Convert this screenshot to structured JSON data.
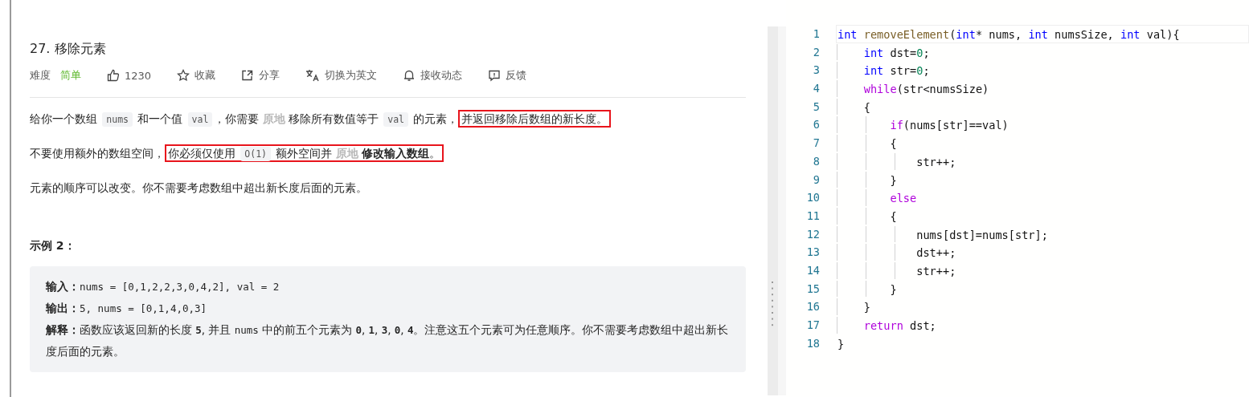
{
  "problem": {
    "title": "27. 移除元素",
    "difficulty": {
      "label": "难度",
      "value": "简单"
    },
    "actions": [
      {
        "kind": "like",
        "label": "1230"
      },
      {
        "kind": "favorite",
        "label": "收藏"
      },
      {
        "kind": "share",
        "label": "分享"
      },
      {
        "kind": "translate",
        "label": "切换为英文"
      },
      {
        "kind": "subscribe",
        "label": "接收动态"
      },
      {
        "kind": "feedback",
        "label": "反馈"
      }
    ],
    "description": [
      {
        "segments": [
          {
            "kind": "text",
            "text": "给你一个数组 "
          },
          {
            "kind": "code",
            "text": "nums"
          },
          {
            "kind": "text",
            "text": " 和一个值 "
          },
          {
            "kind": "code",
            "text": "val"
          },
          {
            "kind": "text",
            "text": "，你需要 "
          },
          {
            "kind": "faded",
            "text": "原地"
          },
          {
            "kind": "text",
            "text": " 移除所有数值等于 "
          },
          {
            "kind": "code",
            "text": "val"
          },
          {
            "kind": "text",
            "text": " 的元素，"
          },
          {
            "kind": "highlight",
            "children": [
              {
                "kind": "text",
                "text": "并返回移除后数组的新长度。"
              }
            ]
          }
        ]
      },
      {
        "segments": [
          {
            "kind": "text",
            "text": "不要使用额外的数组空间，"
          },
          {
            "kind": "highlight",
            "children": [
              {
                "kind": "text",
                "text": "你必须仅使用 "
              },
              {
                "kind": "code",
                "text": "O(1)"
              },
              {
                "kind": "text",
                "text": " 额外空间并 "
              },
              {
                "kind": "faded",
                "text": "原地"
              },
              {
                "kind": "bold",
                "text": " 修改输入数组"
              },
              {
                "kind": "text",
                "text": "。"
              }
            ]
          }
        ]
      },
      {
        "segments": [
          {
            "kind": "text",
            "text": "元素的顺序可以改变。你不需要考虑数组中超出新长度后面的元素。"
          }
        ]
      }
    ],
    "example": {
      "heading": "示例 2：",
      "lines": [
        {
          "segments": [
            {
              "kind": "bold",
              "text": "输入："
            },
            {
              "kind": "mono",
              "text": "nums = [0,1,2,2,3,0,4,2], val = 2"
            }
          ]
        },
        {
          "segments": [
            {
              "kind": "bold",
              "text": "输出："
            },
            {
              "kind": "mono",
              "text": "5, nums = [0,1,4,0,3]"
            }
          ]
        },
        {
          "segments": [
            {
              "kind": "bold",
              "text": "解释："
            },
            {
              "kind": "text",
              "text": "函数应该返回新的长度 "
            },
            {
              "kind": "monobold",
              "text": "5"
            },
            {
              "kind": "text",
              "text": ", 并且 "
            },
            {
              "kind": "mono",
              "text": "nums"
            },
            {
              "kind": "text",
              "text": " 中的前五个元素为 "
            },
            {
              "kind": "monobold",
              "text": "0"
            },
            {
              "kind": "text",
              "text": ", "
            },
            {
              "kind": "monobold",
              "text": "1"
            },
            {
              "kind": "text",
              "text": ", "
            },
            {
              "kind": "monobold",
              "text": "3"
            },
            {
              "kind": "text",
              "text": ", "
            },
            {
              "kind": "monobold",
              "text": "0"
            },
            {
              "kind": "text",
              "text": ", "
            },
            {
              "kind": "monobold",
              "text": "4"
            },
            {
              "kind": "text",
              "text": "。注意这五个元素可为任意顺序。你不需要考虑数组中超出新长度后面的元素。"
            }
          ]
        }
      ]
    }
  },
  "editor": {
    "lines": [
      {
        "number": "1",
        "current": true,
        "tokens": [
          {
            "kind": "keyword",
            "text": "int"
          },
          {
            "kind": "function",
            "text": " removeElement"
          },
          {
            "kind": "plain",
            "text": "("
          },
          {
            "kind": "keyword",
            "text": "int"
          },
          {
            "kind": "plain",
            "text": "* nums, "
          },
          {
            "kind": "keyword",
            "text": "int"
          },
          {
            "kind": "plain",
            "text": " numsSize, "
          },
          {
            "kind": "keyword",
            "text": "int"
          },
          {
            "kind": "plain",
            "text": " val){"
          }
        ]
      },
      {
        "number": "2",
        "current": false,
        "tokens": [
          {
            "kind": "keyword",
            "text": "    int"
          },
          {
            "kind": "plain",
            "text": " dst="
          },
          {
            "kind": "number",
            "text": "0"
          },
          {
            "kind": "plain",
            "text": ";"
          }
        ]
      },
      {
        "number": "3",
        "current": false,
        "tokens": [
          {
            "kind": "keyword",
            "text": "    int"
          },
          {
            "kind": "plain",
            "text": " str="
          },
          {
            "kind": "number",
            "text": "0"
          },
          {
            "kind": "plain",
            "text": ";"
          }
        ]
      },
      {
        "number": "4",
        "current": false,
        "tokens": [
          {
            "kind": "control",
            "text": "    while"
          },
          {
            "kind": "plain",
            "text": "(str<numsSize)"
          }
        ]
      },
      {
        "number": "5",
        "current": false,
        "tokens": [
          {
            "kind": "plain",
            "text": "    {"
          }
        ]
      },
      {
        "number": "6",
        "current": false,
        "tokens": [
          {
            "kind": "control",
            "text": "        if"
          },
          {
            "kind": "plain",
            "text": "(nums[str]==val)"
          }
        ]
      },
      {
        "number": "7",
        "current": false,
        "tokens": [
          {
            "kind": "plain",
            "text": "        {"
          }
        ]
      },
      {
        "number": "8",
        "current": false,
        "tokens": [
          {
            "kind": "plain",
            "text": "            str++;"
          }
        ]
      },
      {
        "number": "9",
        "current": false,
        "tokens": [
          {
            "kind": "plain",
            "text": "        }"
          }
        ]
      },
      {
        "number": "10",
        "current": false,
        "tokens": [
          {
            "kind": "control",
            "text": "        else"
          }
        ]
      },
      {
        "number": "11",
        "current": false,
        "tokens": [
          {
            "kind": "plain",
            "text": "        {"
          }
        ]
      },
      {
        "number": "12",
        "current": false,
        "tokens": [
          {
            "kind": "plain",
            "text": "            nums[dst]=nums[str];"
          }
        ]
      },
      {
        "number": "13",
        "current": false,
        "tokens": [
          {
            "kind": "plain",
            "text": "            dst++;"
          }
        ]
      },
      {
        "number": "14",
        "current": false,
        "tokens": [
          {
            "kind": "plain",
            "text": "            str++;"
          }
        ]
      },
      {
        "number": "15",
        "current": false,
        "tokens": [
          {
            "kind": "plain",
            "text": "        }"
          }
        ]
      },
      {
        "number": "16",
        "current": false,
        "tokens": [
          {
            "kind": "plain",
            "text": "    }"
          }
        ]
      },
      {
        "number": "17",
        "current": false,
        "tokens": [
          {
            "kind": "control",
            "text": "    return"
          },
          {
            "kind": "plain",
            "text": " dst;"
          }
        ]
      },
      {
        "number": "18",
        "current": false,
        "tokens": [
          {
            "kind": "plain",
            "text": "}"
          }
        ]
      }
    ]
  }
}
